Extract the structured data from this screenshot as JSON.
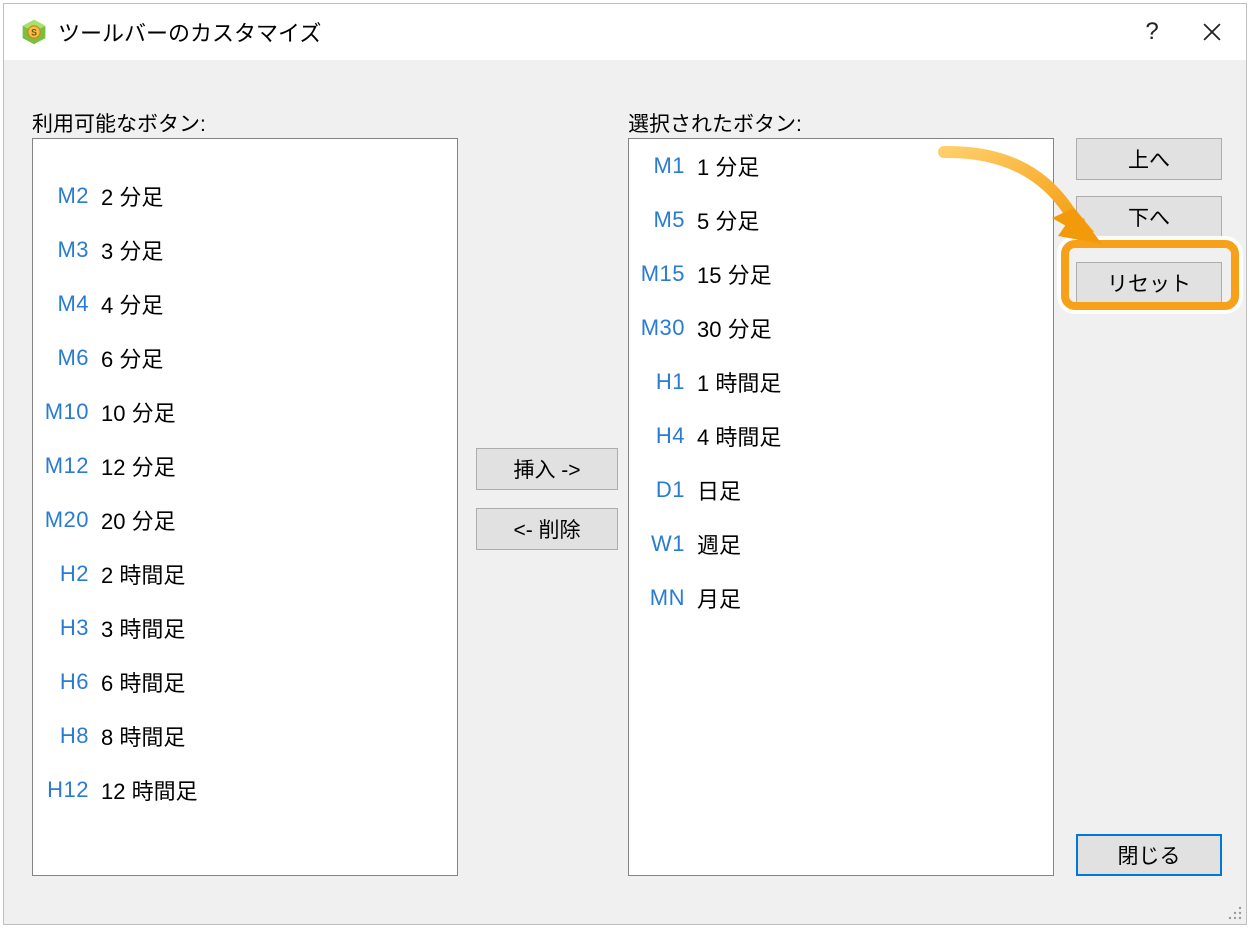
{
  "title": "ツールバーのカスタマイズ",
  "labels": {
    "available": "利用可能なボタン:",
    "selected": "選択されたボタン:"
  },
  "buttons": {
    "insert": "挿入 ->",
    "remove": "<- 削除",
    "up": "上へ",
    "down": "下へ",
    "reset": "リセット",
    "close": "閉じる"
  },
  "available_items": [
    {
      "code": "M2",
      "label": "2 分足"
    },
    {
      "code": "M3",
      "label": "3 分足"
    },
    {
      "code": "M4",
      "label": "4 分足"
    },
    {
      "code": "M6",
      "label": "6 分足"
    },
    {
      "code": "M10",
      "label": "10 分足"
    },
    {
      "code": "M12",
      "label": "12 分足"
    },
    {
      "code": "M20",
      "label": "20 分足"
    },
    {
      "code": "H2",
      "label": "2 時間足"
    },
    {
      "code": "H3",
      "label": "3 時間足"
    },
    {
      "code": "H6",
      "label": "6 時間足"
    },
    {
      "code": "H8",
      "label": "8 時間足"
    },
    {
      "code": "H12",
      "label": "12 時間足"
    }
  ],
  "selected_items": [
    {
      "code": "M1",
      "label": "1 分足"
    },
    {
      "code": "M5",
      "label": "5 分足"
    },
    {
      "code": "M15",
      "label": "15 分足"
    },
    {
      "code": "M30",
      "label": "30 分足"
    },
    {
      "code": "H1",
      "label": "1 時間足"
    },
    {
      "code": "H4",
      "label": "4 時間足"
    },
    {
      "code": "D1",
      "label": "日足"
    },
    {
      "code": "W1",
      "label": "週足"
    },
    {
      "code": "MN",
      "label": "月足"
    }
  ]
}
